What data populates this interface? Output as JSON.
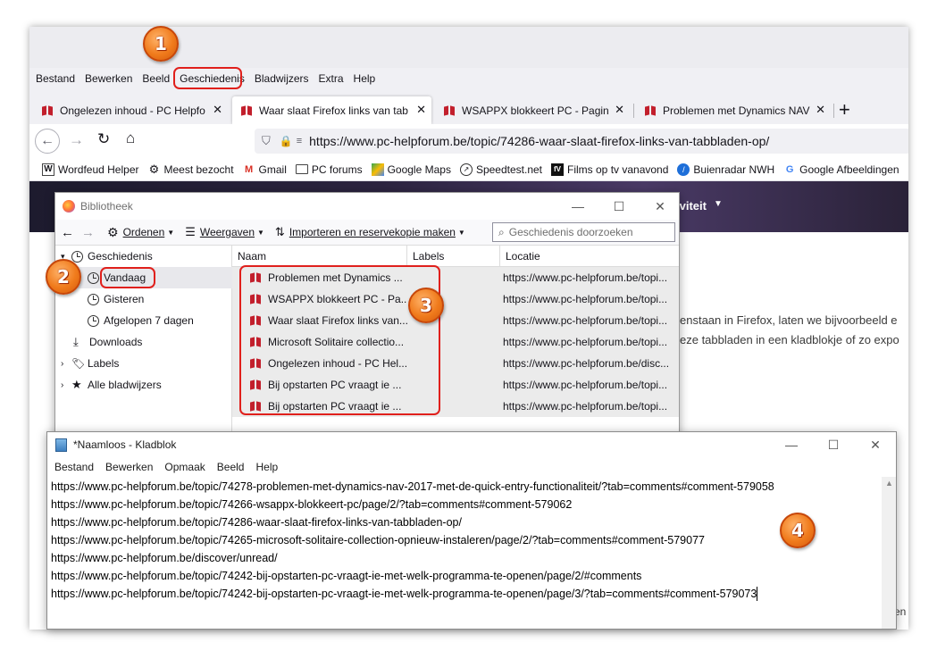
{
  "firefox": {
    "menubar": [
      "Bestand",
      "Bewerken",
      "Beeld",
      "Geschiedenis",
      "Bladwijzers",
      "Extra",
      "Help"
    ],
    "tabs": [
      {
        "title": "Ongelezen inhoud - PC Helpfo",
        "active": false
      },
      {
        "title": "Waar slaat Firefox links van tab",
        "active": true
      },
      {
        "title": "WSAPPX blokkeert PC - Pagina",
        "active": false
      },
      {
        "title": "Problemen met Dynamics NAV",
        "active": false
      }
    ],
    "new_tab": "+",
    "url": "https://www.pc-helpforum.be/topic/74286-waar-slaat-firefox-links-van-tabbladen-op/",
    "bookmarks": [
      {
        "label": "Wordfeud Helper",
        "icon": "W"
      },
      {
        "label": "Meest bezocht",
        "icon": "gear"
      },
      {
        "label": "Gmail",
        "icon": "M"
      },
      {
        "label": "PC forums",
        "icon": "folder"
      },
      {
        "label": "Google Maps",
        "icon": "map"
      },
      {
        "label": "Speedtest.net",
        "icon": "gauge"
      },
      {
        "label": "Films op tv vanavond",
        "icon": "fv"
      },
      {
        "label": "Buienradar NWH",
        "icon": "weather"
      },
      {
        "label": "Google Afbeeldingen",
        "icon": "G"
      }
    ],
    "page": {
      "header_fragment": "iviteit",
      "text_lines": [
        "enstaan in Firefox, laten we bijvoorbeeld e",
        "eze tabbladen in een kladblokje of zo expo"
      ],
      "right_fragment": "en"
    }
  },
  "library": {
    "title": "Bibliotheek",
    "toolbar": {
      "organize": "Ordenen",
      "views": "Weergaven",
      "import": "Importeren en reservekopie maken"
    },
    "search_placeholder": "Geschiedenis doorzoeken",
    "tree": [
      {
        "label": "Geschiedenis",
        "icon": "clock"
      },
      {
        "label": "Vandaag",
        "icon": "clock",
        "selected": true
      },
      {
        "label": "Gisteren",
        "icon": "clock"
      },
      {
        "label": "Afgelopen 7 dagen",
        "icon": "clock"
      },
      {
        "label": "Downloads",
        "icon": "download"
      },
      {
        "label": "Labels",
        "icon": "tag"
      },
      {
        "label": "Alle bladwijzers",
        "icon": "star"
      }
    ],
    "columns": [
      "Naam",
      "Labels",
      "Locatie"
    ],
    "rows": [
      {
        "name": "Problemen met Dynamics ...",
        "location": "https://www.pc-helpforum.be/topi..."
      },
      {
        "name": "WSAPPX blokkeert PC - Pa...",
        "location": "https://www.pc-helpforum.be/topi..."
      },
      {
        "name": "Waar slaat Firefox links van...",
        "location": "https://www.pc-helpforum.be/topi..."
      },
      {
        "name": "Microsoft Solitaire collectio...",
        "location": "https://www.pc-helpforum.be/topi..."
      },
      {
        "name": "Ongelezen inhoud - PC Hel...",
        "location": "https://www.pc-helpforum.be/disc..."
      },
      {
        "name": "Bij opstarten PC vraagt ie ...",
        "location": "https://www.pc-helpforum.be/topi..."
      },
      {
        "name": "Bij opstarten PC vraagt ie ...",
        "location": "https://www.pc-helpforum.be/topi..."
      }
    ]
  },
  "notepad": {
    "title": "*Naamloos - Kladblok",
    "menu": [
      "Bestand",
      "Bewerken",
      "Opmaak",
      "Beeld",
      "Help"
    ],
    "lines": [
      "https://www.pc-helpforum.be/topic/74278-problemen-met-dynamics-nav-2017-met-de-quick-entry-functionaliteit/?tab=comments#comment-579058",
      "https://www.pc-helpforum.be/topic/74266-wsappx-blokkeert-pc/page/2/?tab=comments#comment-579062",
      "https://www.pc-helpforum.be/topic/74286-waar-slaat-firefox-links-van-tabbladen-op/",
      "https://www.pc-helpforum.be/topic/74265-microsoft-solitaire-collection-opnieuw-instaleren/page/2/?tab=comments#comment-579077",
      "https://www.pc-helpforum.be/discover/unread/",
      "https://www.pc-helpforum.be/topic/74242-bij-opstarten-pc-vraagt-ie-met-welk-programma-te-openen/page/2/#comments",
      "https://www.pc-helpforum.be/topic/74242-bij-opstarten-pc-vraagt-ie-met-welk-programma-te-openen/page/3/?tab=comments#comment-579073"
    ]
  },
  "callouts": [
    "1",
    "2",
    "3",
    "4"
  ],
  "colors": {
    "callout": "#f07b1c",
    "highlight": "#e0201c",
    "favicon_red": "#c21f2c"
  }
}
